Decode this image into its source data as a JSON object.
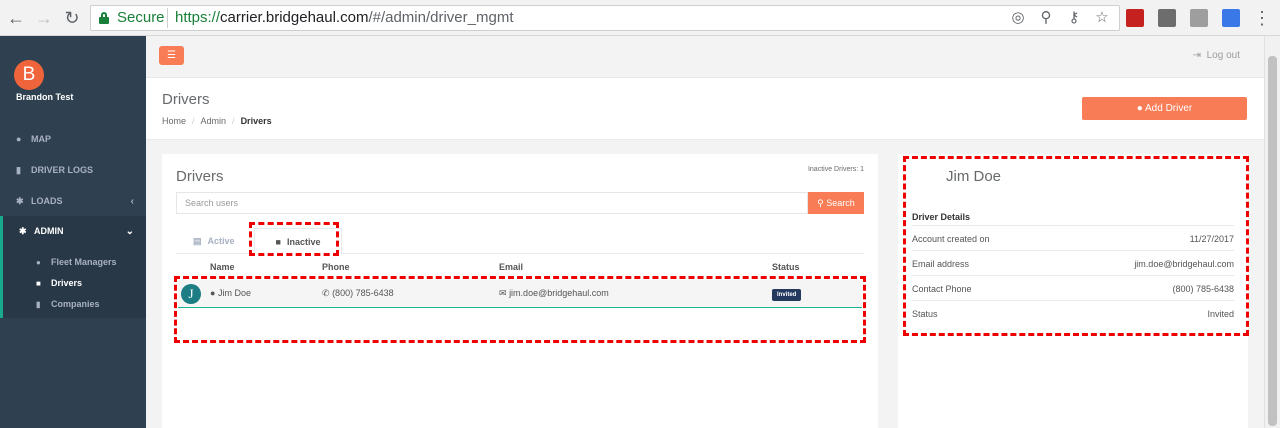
{
  "browser": {
    "secure_label": "Secure",
    "url_scheme": "https://",
    "url_host": "carrier.bridgehaul.com",
    "url_path": "/#/admin/driver_mgmt"
  },
  "sidebar": {
    "avatar_letter": "B",
    "user_name": "Brandon Test",
    "items": [
      {
        "label": "MAP",
        "icon": "map-marker-icon"
      },
      {
        "label": "DRIVER LOGS",
        "icon": "book-icon"
      },
      {
        "label": "LOADS",
        "icon": "gear-icon"
      },
      {
        "label": "ADMIN",
        "icon": "gear-icon"
      }
    ],
    "submenu": [
      {
        "label": "Fleet Managers",
        "icon": "users-icon"
      },
      {
        "label": "Drivers",
        "icon": "id-card-icon"
      },
      {
        "label": "Companies",
        "icon": "building-icon"
      }
    ]
  },
  "topbar": {
    "logout_label": "Log out"
  },
  "heading": {
    "title": "Drivers",
    "breadcrumb": [
      "Home",
      "Admin",
      "Drivers"
    ],
    "add_driver_label": "Add Driver"
  },
  "drivers_panel": {
    "title": "Drivers",
    "inactive_count": "Inactive Drivers: 1",
    "search_placeholder": "Search users",
    "search_button": "Search",
    "tabs": {
      "active": "Active",
      "inactive": "Inactive"
    },
    "columns": [
      "Name",
      "Phone",
      "Email",
      "Status"
    ],
    "rows": [
      {
        "initial": "J",
        "name": "Jim Doe",
        "phone": "(800) 785-6438",
        "email": "jim.doe@bridgehaul.com",
        "status": "Invited"
      }
    ]
  },
  "detail_panel": {
    "name": "Jim Doe",
    "section_title": "Driver Details",
    "fields": [
      {
        "key": "Account created on",
        "value": "11/27/2017"
      },
      {
        "key": "Email address",
        "value": "jim.doe@bridgehaul.com"
      },
      {
        "key": "Contact Phone",
        "value": "(800) 785-6438"
      },
      {
        "key": "Status",
        "value": "Invited"
      }
    ]
  },
  "colors": {
    "brand_orange": "#f87c56",
    "sidebar_bg": "#2f4050",
    "annotation_red": "#e00000"
  }
}
